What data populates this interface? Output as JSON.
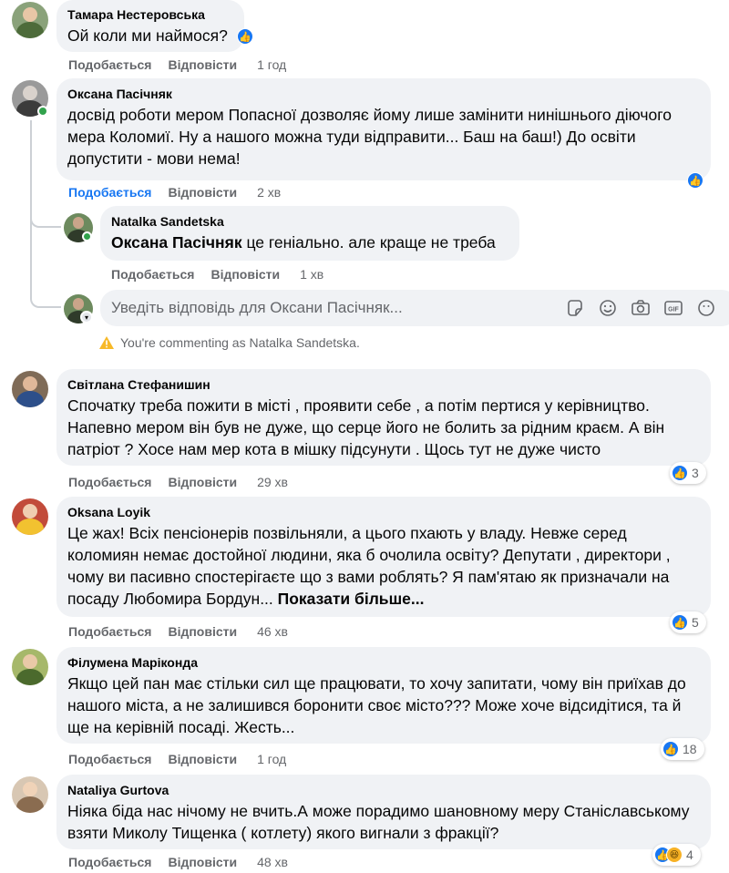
{
  "labels": {
    "like": "Подобається",
    "reply": "Відповісти"
  },
  "comments": [
    {
      "author": "Тамара Нестеровська",
      "text": "Ой коли ми наймося?",
      "time": "1 год"
    },
    {
      "author": "Оксана Пасічняк",
      "text": "досвід роботи мером Попасної дозволяє йому лише замінити нинішнього діючого мера Коломиї. Ну а нашого можна туди відправити... Баш на баш!) До освіти допустити - мови нема!",
      "time": "2 хв"
    },
    {
      "author": "Svitlana",
      "author_display": "Світлана Стефанишин",
      "text": "Спочатку треба пожити в місті , проявити себе , а потім пертися у керівництво. Напевно мером він був не дуже, що серце його не болить за рідним краєм. А він патріот ? Хосе нам мер кота в мішку підсунути . Щось тут не дуже чисто",
      "time": "29 хв",
      "reactions": "3"
    },
    {
      "author": "Oksana Loyik",
      "text": "Це жах! Всіх пенсіонерів позвільняли, а цього пхають у владу. Невже серед коломиян немає достойної людини, яка б очолила освіту? Депутати , директори , чому ви пасивно спостерігаєте що з вами роблять? Я пам'ятаю як призначали на посаду Любомира Бордун...",
      "see_more": "Показати більше...",
      "time": "46 хв",
      "reactions": "5"
    },
    {
      "author": "Філумена Маріконда",
      "text": "Якщо цей пан має стільки сил ще працювати, то хочу запитати, чому він приїхав до нашого міста, а не залишився боронити своє місто??? Може хоче відсидітися, та й ще на керівній посаді. Жесть...",
      "time": "1 год",
      "reactions": "18"
    },
    {
      "author": "Nataliya Gurtova",
      "text": "Ніяка біда нас нічому не вчить.А може порадимо шановному меру Станіславському взяти Миколу Тищенка ( котлету) якого вигнали з фракції?",
      "time": "48 хв",
      "reactions": "4"
    }
  ],
  "reply": {
    "author": "Natalka Sandetska",
    "mention": "Оксана Пасічняк",
    "text": " це геніально. але краще не треба",
    "time": "1 хв"
  },
  "composer": {
    "placeholder": "Уведіть відповідь для Оксани Пасічняк...",
    "notice": "You're commenting as Natalka Sandetska.",
    "gif_label": "GIF"
  },
  "colors": {
    "accent": "#1877f2",
    "bubble": "#f0f2f5",
    "muted": "#65676b",
    "online": "#31a24c"
  }
}
